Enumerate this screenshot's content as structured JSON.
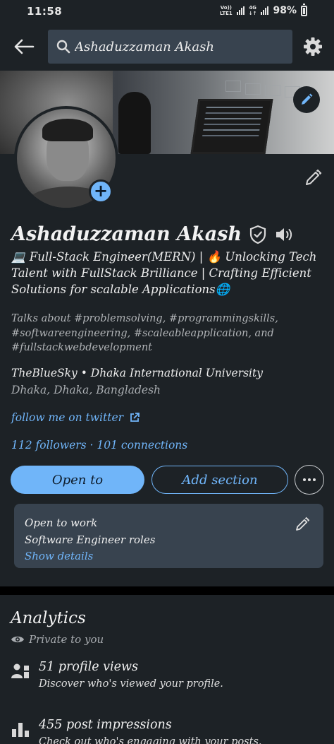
{
  "status_bar": {
    "time": "11:58",
    "network_top": "Vo))",
    "network_bottom": "LTE1",
    "network2_top": "4G",
    "network2_bottom": "↓↑",
    "battery": "98%"
  },
  "search": {
    "query": "Ashaduzzaman Akash"
  },
  "profile": {
    "name": "Ashaduzzaman Akash",
    "headline": "💻 Full-Stack Engineer(MERN) | 🔥 Unlocking Tech Talent with FullStack Brilliance | Crafting Efficient Solutions for scalable Applications🌐",
    "talks_about": "Talks about #problemsolving, #programmingskills, #softwareengineering, #scaleableapplication, and #fullstackwebdevelopment",
    "company": "TheBlueSky • Dhaka International University",
    "location": "Dhaka, Dhaka, Bangladesh",
    "link_label": "follow me on twitter",
    "counts": "112 followers · 101 connections"
  },
  "actions": {
    "open_to": "Open to",
    "add_section": "Add section"
  },
  "open_to_work": {
    "title": "Open to work",
    "roles": "Software Engineer roles",
    "show_details": "Show details"
  },
  "analytics": {
    "title": "Analytics",
    "private": "Private to you",
    "items": [
      {
        "title": "51 profile views",
        "subtitle": "Discover who's viewed your profile."
      },
      {
        "title": "455 post impressions",
        "subtitle": "Check out who's engaging with your posts."
      }
    ]
  },
  "colors": {
    "accent": "#70b5f9",
    "background": "#1d2226",
    "card": "#38434f"
  }
}
